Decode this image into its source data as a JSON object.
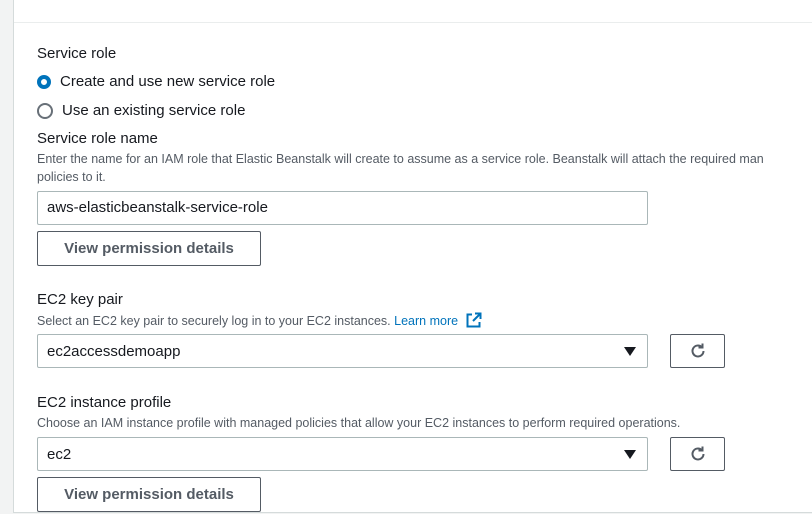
{
  "service_role": {
    "label": "Service role",
    "options": [
      {
        "label": "Create and use new service role",
        "checked": true
      },
      {
        "label": "Use an existing service role",
        "checked": false
      }
    ]
  },
  "service_role_name": {
    "label": "Service role name",
    "description_line1": "Enter the name for an IAM role that Elastic Beanstalk will create to assume as a service role. Beanstalk will attach the required man",
    "description_line2": "policies to it.",
    "value": "aws-elasticbeanstalk-service-role",
    "view_button": "View permission details"
  },
  "ec2_key_pair": {
    "label": "EC2 key pair",
    "description": "Select an EC2 key pair to securely log in to your EC2 instances.",
    "learn_more": "Learn more",
    "selected": "ec2accessdemoapp"
  },
  "ec2_instance_profile": {
    "label": "EC2 instance profile",
    "description": "Choose an IAM instance profile with managed policies that allow your EC2 instances to perform required operations.",
    "selected": "ec2",
    "view_button": "View permission details"
  },
  "colors": {
    "accent": "#0073bb",
    "text": "#16191f",
    "secondary_text": "#545b64",
    "border": "#aab7b8"
  }
}
